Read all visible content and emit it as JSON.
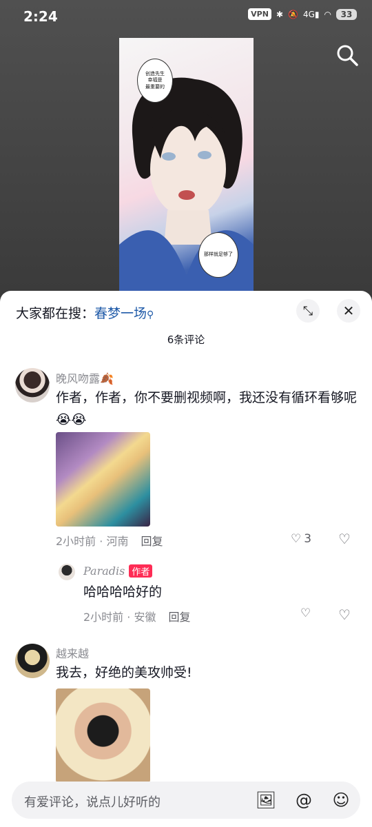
{
  "status": {
    "time": "2:24",
    "vpn": "VPN",
    "network": "4G",
    "battery": "33"
  },
  "video": {
    "bubble1": "创造先生\n幸福是\n最重要的",
    "bubble2": "那样就足够了"
  },
  "sheet": {
    "trend_label": "大家都在搜：",
    "trend_keyword": "春梦一场",
    "comment_count": "6条评论"
  },
  "comments": [
    {
      "user": "晚风吻露🍂",
      "text": "作者，作者，你不要删视频啊，我还没有循环看够呢😭😭",
      "time": "2小时前 · 河南",
      "reply": "回复",
      "likes": "3"
    },
    {
      "user": "Paradis",
      "badge": "作者",
      "text": "哈哈哈哈好的",
      "time": "2小时前 · 安徽",
      "reply": "回复"
    },
    {
      "user": "越来越",
      "text": "我去，好绝的美攻帅受!"
    }
  ],
  "input": {
    "placeholder": "有爱评论，说点儿好听的"
  },
  "icons": {
    "search": "search-icon",
    "expand": "expand-icon",
    "close": "close-icon",
    "image": "image-icon",
    "at": "at-icon",
    "emoji": "emoji-icon",
    "heart": "heart-icon",
    "dislike": "broken-heart-icon"
  }
}
